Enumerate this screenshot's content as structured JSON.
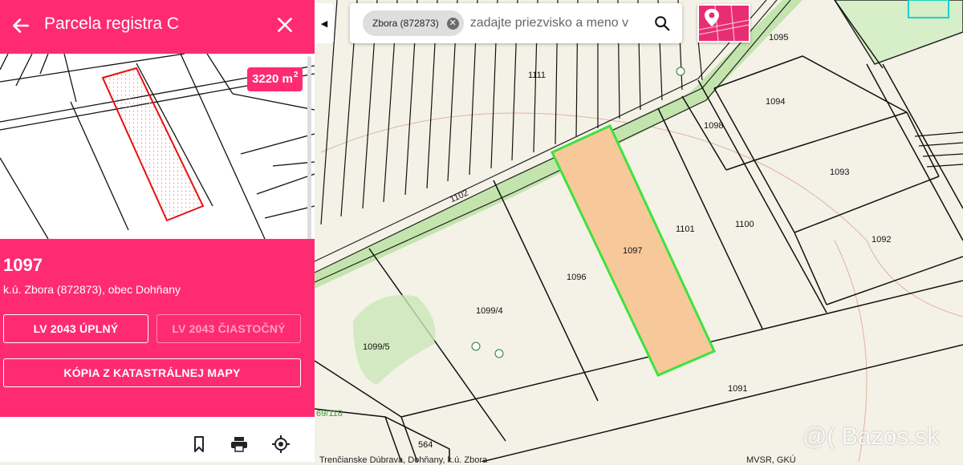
{
  "panel": {
    "title": "Parcela registra C",
    "parcel_number": "1097",
    "location": "k.ú. Zbora (872873), obec Dohňany",
    "area_value": "3220 m",
    "area_unit_sup": "2",
    "buttons": {
      "full": "LV 2043 ÚPLNÝ",
      "partial": "LV 2043 ČIASTOČNÝ",
      "copy": "KÓPIA Z KATASTRÁLNEJ MAPY"
    },
    "footer_icons": [
      "bookmark-icon",
      "print-icon",
      "gps-icon"
    ]
  },
  "search": {
    "chip_label": "Zbora (872873)",
    "placeholder": "zadajte priezvisko a meno v"
  },
  "map": {
    "labels": [
      "1111",
      "1095",
      "1097",
      "1094",
      "1098",
      "1093",
      "1102",
      "1101",
      "1100",
      "1092",
      "1096",
      "1099/4",
      "1099/5",
      "1091",
      "564",
      "69/118"
    ],
    "selected_fill": "#f7c99a",
    "selected_stroke": "#3ee23e"
  },
  "footer": {
    "left_text": "Trenčianske Dúbrava, Dohňany, k.ú. Zbora",
    "right_text": "MVSR, GKÚ"
  },
  "watermark": "@( Bazos.sk",
  "colors": {
    "accent": "#ff2b72"
  }
}
